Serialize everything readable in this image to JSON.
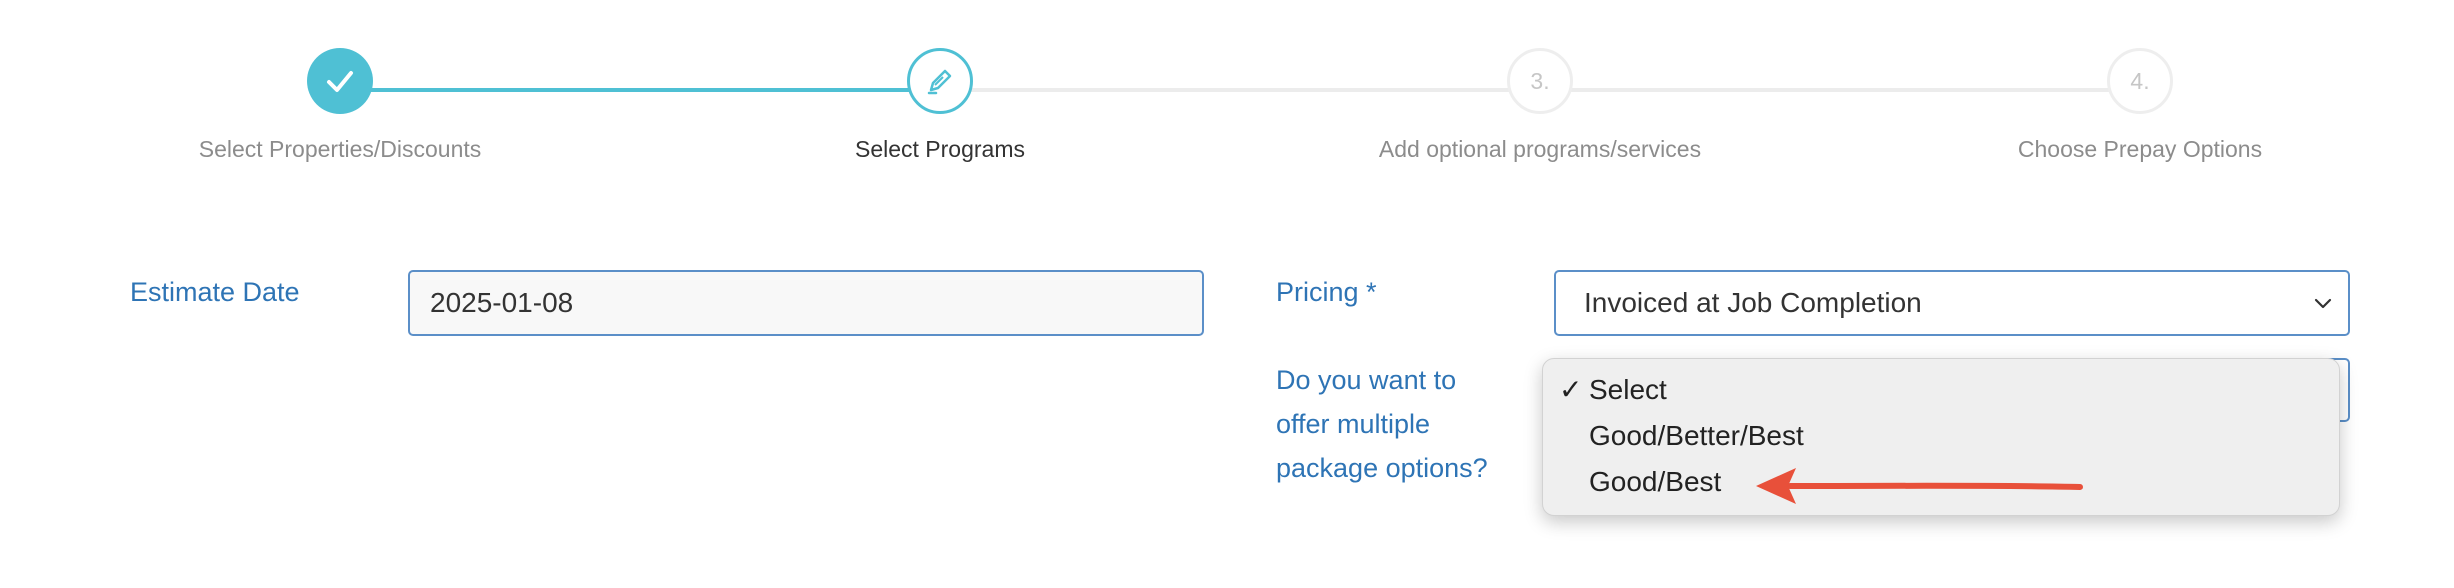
{
  "stepper": {
    "steps": [
      {
        "label": "Select Properties/Discounts",
        "state": "done",
        "icon": "check-icon"
      },
      {
        "label": "Select Programs",
        "state": "active",
        "icon": "pencil-icon"
      },
      {
        "label": "Add optional programs/services",
        "state": "pending",
        "number": "3."
      },
      {
        "label": "Choose Prepay Options",
        "state": "pending",
        "number": "4."
      }
    ],
    "accent_color": "#4fc0d4"
  },
  "form": {
    "estimate_date": {
      "label": "Estimate Date",
      "value": "2025-01-08"
    },
    "pricing": {
      "label": "Pricing *",
      "value": "Invoiced at Job Completion"
    },
    "package_options": {
      "label_lines": [
        "Do you want to",
        "offer multiple",
        "package options?"
      ],
      "options": [
        "Select",
        "Good/Better/Best",
        "Good/Best"
      ],
      "selected": "Select"
    }
  },
  "colors": {
    "label_blue": "#2e74b5",
    "input_border": "#5b8fc8",
    "annotation_arrow": "#e8503a"
  }
}
